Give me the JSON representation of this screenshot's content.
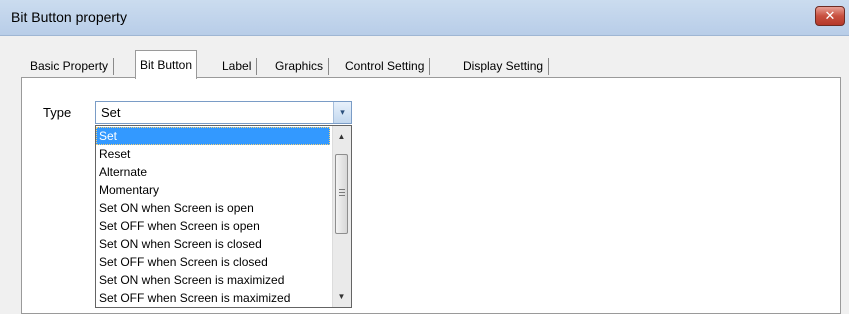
{
  "window": {
    "title": "Bit Button property",
    "close_glyph": "✕"
  },
  "tabs": [
    {
      "label": "Basic Property",
      "active": false
    },
    {
      "label": "Bit Button",
      "active": true
    },
    {
      "label": "Label",
      "active": false
    },
    {
      "label": "Graphics",
      "active": false
    },
    {
      "label": "Control Setting",
      "active": false
    },
    {
      "label": "Display Setting",
      "active": false
    }
  ],
  "type_field": {
    "label": "Type",
    "value": "Set",
    "arrow_glyph": "▾"
  },
  "dropdown": {
    "options": [
      "Set",
      "Reset",
      "Alternate",
      "Momentary",
      "Set ON when Screen is open",
      "Set OFF when Screen is open",
      "Set ON when Screen is closed",
      "Set OFF when Screen is closed",
      "Set ON when Screen is maximized",
      "Set OFF when Screen is maximized"
    ],
    "selected_index": 0,
    "scroll_up_glyph": "▲",
    "scroll_down_glyph": "▼"
  },
  "colors": {
    "selection": "#3399ff",
    "close_button": "#c8503f",
    "title_bar": "#c2d5ec"
  }
}
